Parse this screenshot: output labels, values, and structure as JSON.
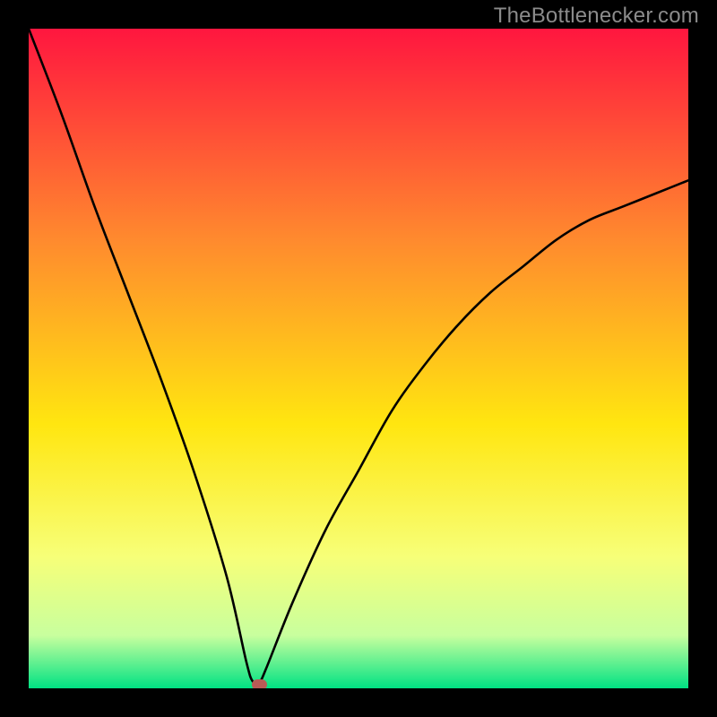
{
  "watermark": "TheBottlenecker.com",
  "colors": {
    "top": "#ff163f",
    "mid_upper": "#ff8a2e",
    "mid": "#ffe610",
    "mid_lower": "#f7ff78",
    "near_bottom": "#c8ff9e",
    "bottom": "#00e283",
    "curve": "#000000",
    "dot": "#b95b56"
  },
  "chart_data": {
    "type": "line",
    "title": "",
    "xlabel": "",
    "ylabel": "",
    "xlim": [
      0,
      100
    ],
    "ylim": [
      0,
      100
    ],
    "notch_x": 34,
    "dot": {
      "x": 35,
      "y": 0.5
    },
    "series": [
      {
        "name": "bottleneck-curve",
        "x": [
          0,
          5,
          10,
          15,
          20,
          25,
          30,
          33,
          34,
          35,
          36,
          40,
          45,
          50,
          55,
          60,
          65,
          70,
          75,
          80,
          85,
          90,
          95,
          100
        ],
        "y": [
          100,
          87,
          73,
          60,
          47,
          33,
          17,
          4,
          1,
          1,
          3,
          13,
          24,
          33,
          42,
          49,
          55,
          60,
          64,
          68,
          71,
          73,
          75,
          77
        ]
      }
    ],
    "gradient_stops": [
      {
        "pct": 0,
        "color": "#ff163f"
      },
      {
        "pct": 32,
        "color": "#ff8a2e"
      },
      {
        "pct": 60,
        "color": "#ffe610"
      },
      {
        "pct": 80,
        "color": "#f7ff78"
      },
      {
        "pct": 92,
        "color": "#c8ff9e"
      },
      {
        "pct": 100,
        "color": "#00e283"
      }
    ]
  }
}
